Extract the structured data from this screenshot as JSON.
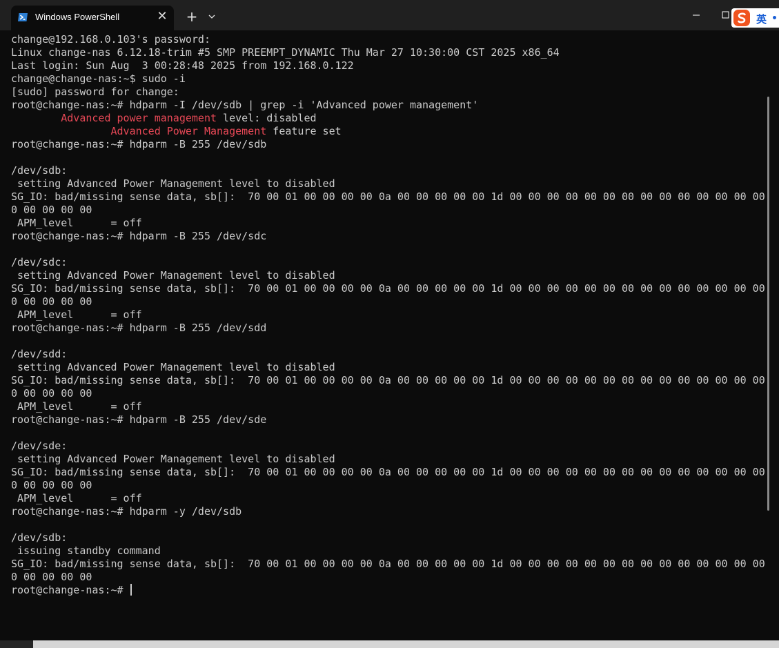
{
  "window": {
    "tab_title": "Windows PowerShell",
    "tab_icon": "powershell-icon",
    "close_icon": "close-icon",
    "new_tab_label": "+",
    "dropdown_icon": "chevron-down-icon",
    "minimize_icon": "minimize-icon",
    "maximize_icon": "maximize-icon"
  },
  "ime": {
    "logo_icon": "sogou-ime-icon",
    "mode_label": "英"
  },
  "colors": {
    "terminal_bg": "#0c0c0c",
    "terminal_fg": "#cccccc",
    "highlight": "#e74856"
  },
  "terminal": {
    "lines": [
      "change@192.168.0.103's password:",
      "Linux change-nas 6.12.18-trim #5 SMP PREEMPT_DYNAMIC Thu Mar 27 10:30:00 CST 2025 x86_64",
      "Last login: Sun Aug  3 00:28:48 2025 from 192.168.0.122",
      "change@change-nas:~$ sudo -i",
      "[sudo] password for change:",
      "root@change-nas:~# hdparm -I /dev/sdb | grep -i 'Advanced power management'",
      {
        "pre": "        ",
        "hl": "Advanced power management",
        "post": " level: disabled"
      },
      {
        "pre": "                ",
        "hl": "Advanced Power Management",
        "post": " feature set"
      },
      "root@change-nas:~# hdparm -B 255 /dev/sdb",
      "",
      "/dev/sdb:",
      " setting Advanced Power Management level to disabled",
      "SG_IO: bad/missing sense data, sb[]:  70 00 01 00 00 00 00 0a 00 00 00 00 00 1d 00 00 00 00 00 00 00 00 00 00 00 00 00 00 0",
      "0 00 00 00 00",
      " APM_level      = off",
      "root@change-nas:~# hdparm -B 255 /dev/sdc",
      "",
      "/dev/sdc:",
      " setting Advanced Power Management level to disabled",
      "SG_IO: bad/missing sense data, sb[]:  70 00 01 00 00 00 00 0a 00 00 00 00 00 1d 00 00 00 00 00 00 00 00 00 00 00 00 00 00 0",
      "0 00 00 00 00",
      " APM_level      = off",
      "root@change-nas:~# hdparm -B 255 /dev/sdd",
      "",
      "/dev/sdd:",
      " setting Advanced Power Management level to disabled",
      "SG_IO: bad/missing sense data, sb[]:  70 00 01 00 00 00 00 0a 00 00 00 00 00 1d 00 00 00 00 00 00 00 00 00 00 00 00 00 00 0",
      "0 00 00 00 00",
      " APM_level      = off",
      "root@change-nas:~# hdparm -B 255 /dev/sde",
      "",
      "/dev/sde:",
      " setting Advanced Power Management level to disabled",
      "SG_IO: bad/missing sense data, sb[]:  70 00 01 00 00 00 00 0a 00 00 00 00 00 1d 00 00 00 00 00 00 00 00 00 00 00 00 00 00 0",
      "0 00 00 00 00",
      " APM_level      = off",
      "root@change-nas:~# hdparm -y /dev/sdb",
      "",
      "/dev/sdb:",
      " issuing standby command",
      "SG_IO: bad/missing sense data, sb[]:  70 00 01 00 00 00 00 0a 00 00 00 00 00 1d 00 00 00 00 00 00 00 00 00 00 00 00 00 00 0",
      "0 00 00 00 00"
    ],
    "prompt": "root@change-nas:~# "
  }
}
